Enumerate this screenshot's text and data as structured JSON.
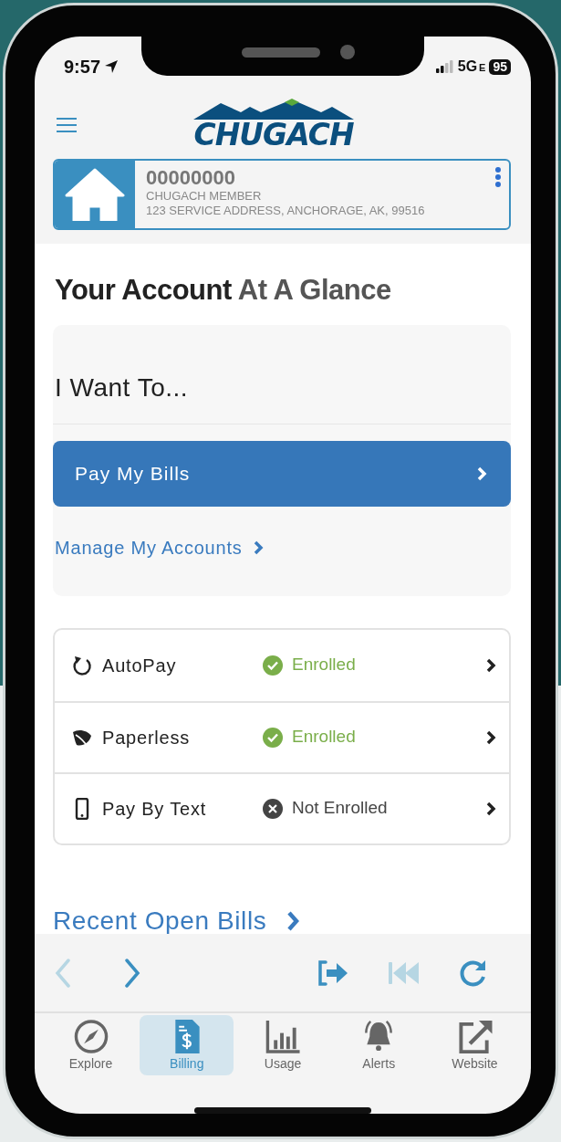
{
  "status_bar": {
    "time": "9:57",
    "network": "5G",
    "network_suffix": "E",
    "battery": "95"
  },
  "logo": {
    "text": "CHUGACH"
  },
  "account": {
    "number": "00000000",
    "name": "CHUGACH MEMBER",
    "address": "123 SERVICE ADDRESS, ANCHORAGE, AK, 99516"
  },
  "heading": {
    "main": "Your Account",
    "rest": "At A Glance"
  },
  "actions": {
    "title": "I Want To...",
    "primary": "Pay My Bills",
    "link": "Manage My Accounts"
  },
  "programs": [
    {
      "kind": "autopay",
      "label": "AutoPay",
      "enrolled": true,
      "status": "Enrolled"
    },
    {
      "kind": "paperless",
      "label": "Paperless",
      "enrolled": true,
      "status": "Enrolled"
    },
    {
      "kind": "text",
      "label": "Pay By Text",
      "enrolled": false,
      "status": "Not Enrolled"
    }
  ],
  "recent_bills": "Recent Open Bills",
  "toolbar": [
    {
      "kind": "back",
      "disabled": true
    },
    {
      "kind": "forward",
      "disabled": false
    },
    {
      "kind": "exit",
      "disabled": false
    },
    {
      "kind": "rewind",
      "disabled": true
    },
    {
      "kind": "reload",
      "disabled": false
    }
  ],
  "tabs": [
    {
      "kind": "explore",
      "label": "Explore",
      "selected": false
    },
    {
      "kind": "billing",
      "label": "Billing",
      "selected": true
    },
    {
      "kind": "usage",
      "label": "Usage",
      "selected": false
    },
    {
      "kind": "alerts",
      "label": "Alerts",
      "selected": false
    },
    {
      "kind": "website",
      "label": "Website",
      "selected": false
    }
  ]
}
